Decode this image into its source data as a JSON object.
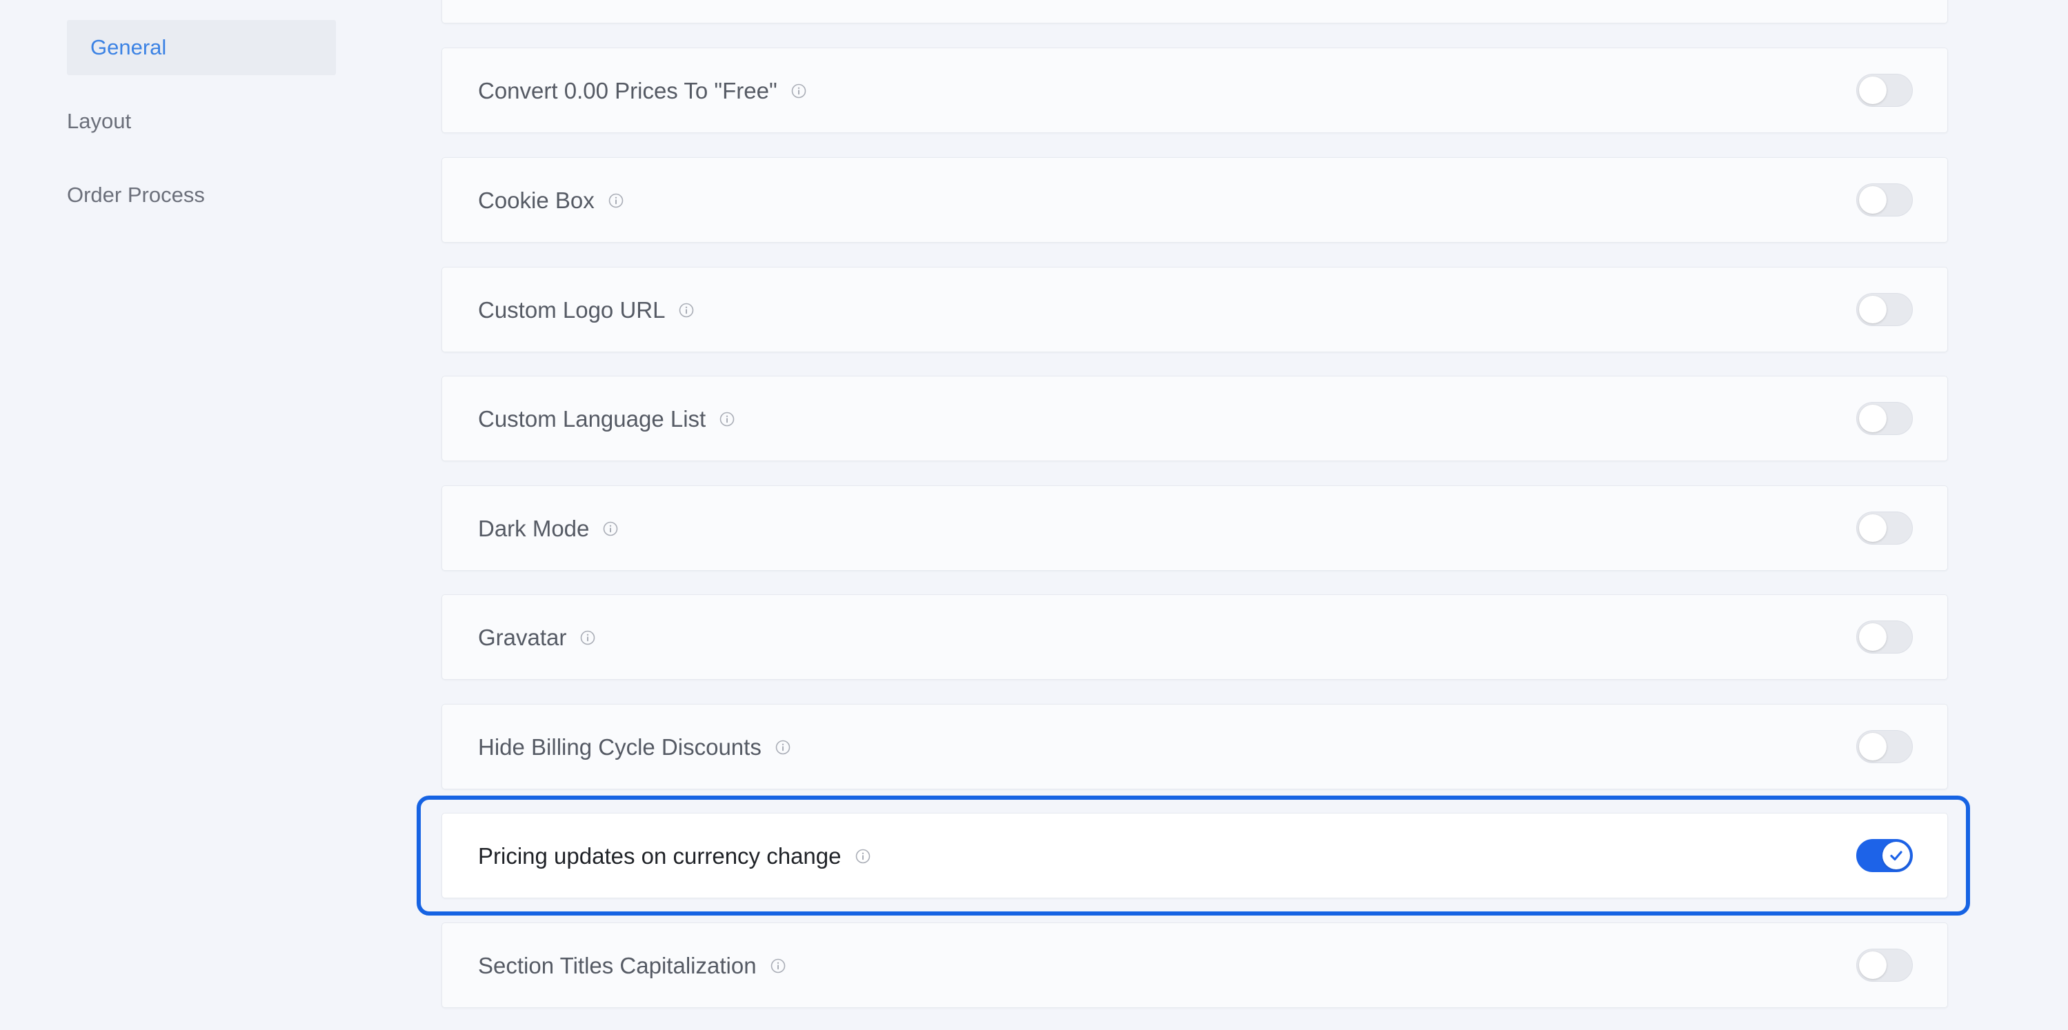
{
  "sidebar": {
    "items": [
      {
        "label": "General",
        "active": true
      },
      {
        "label": "Layout",
        "active": false
      },
      {
        "label": "Order Process",
        "active": false
      }
    ]
  },
  "settings": [
    {
      "label": "",
      "enabled": false
    },
    {
      "label": "Convert 0.00 Prices To \"Free\"",
      "enabled": false
    },
    {
      "label": "Cookie Box",
      "enabled": false
    },
    {
      "label": "Custom Logo URL",
      "enabled": false
    },
    {
      "label": "Custom Language List",
      "enabled": false
    },
    {
      "label": "Dark Mode",
      "enabled": false
    },
    {
      "label": "Gravatar",
      "enabled": false
    },
    {
      "label": "Hide Billing Cycle Discounts",
      "enabled": false
    },
    {
      "label": "Pricing updates on currency change",
      "enabled": true,
      "highlighted": true
    },
    {
      "label": "Section Titles Capitalization",
      "enabled": false
    }
  ],
  "colors": {
    "accent": "#1d63e8",
    "highlight_border": "#1663e3",
    "active_nav_text": "#3b82e4",
    "background": "#f3f5fa"
  },
  "icons": {
    "info": "info-icon",
    "check": "check-icon"
  }
}
